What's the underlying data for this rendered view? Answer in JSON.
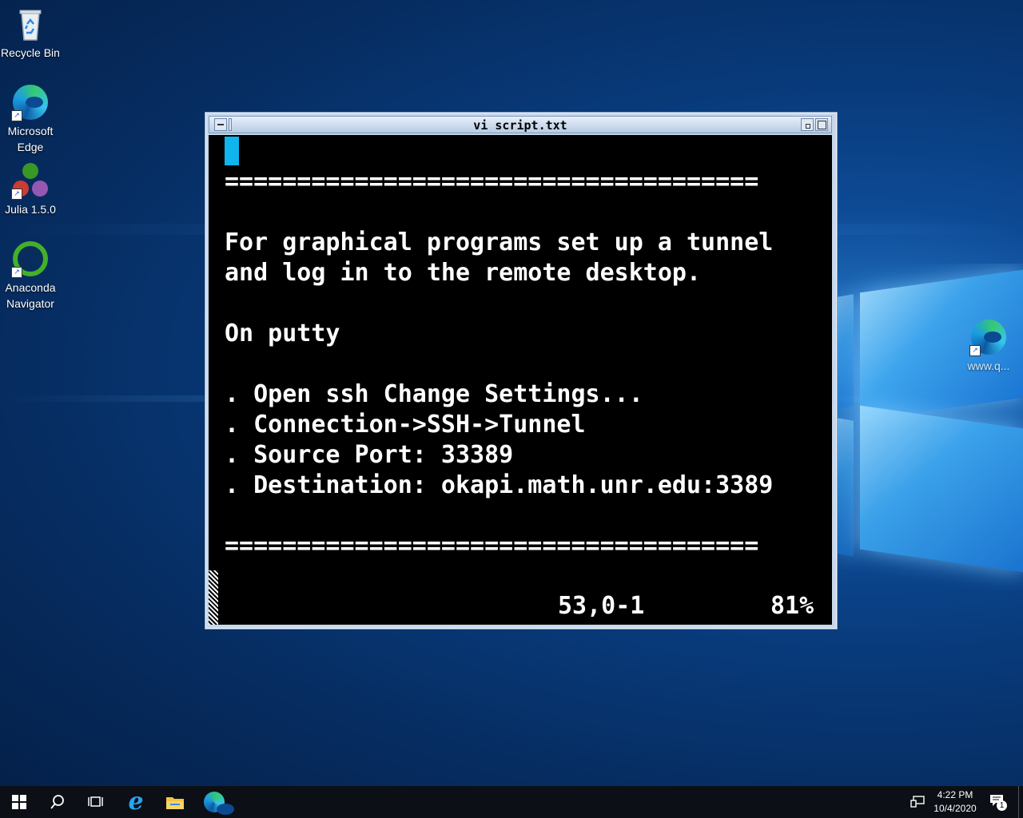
{
  "desktop": {
    "icons": [
      {
        "label": "Recycle Bin"
      },
      {
        "label": "Microsoft Edge"
      },
      {
        "label": "Julia 1.5.0"
      },
      {
        "label": "Anaconda Navigator"
      },
      {
        "label": "www.q..."
      }
    ]
  },
  "window": {
    "title": "vi script.txt",
    "lines": [
      "=====================================",
      "",
      "For graphical programs set up a tunnel",
      "and log in to the remote desktop.",
      "",
      "On putty",
      "",
      ". Open ssh Change Settings...",
      ". Connection->SSH->Tunnel",
      ". Source Port: 33389",
      ". Destination: okapi.math.unr.edu:3389",
      "",
      "====================================="
    ],
    "status": {
      "position": "53,0-1",
      "percent": "81%"
    }
  },
  "taskbar": {
    "time": "4:22 PM",
    "date": "10/4/2020",
    "notifications": "1"
  },
  "colors": {
    "cursor": "#10b4ee",
    "terminal_bg": "#000000"
  }
}
